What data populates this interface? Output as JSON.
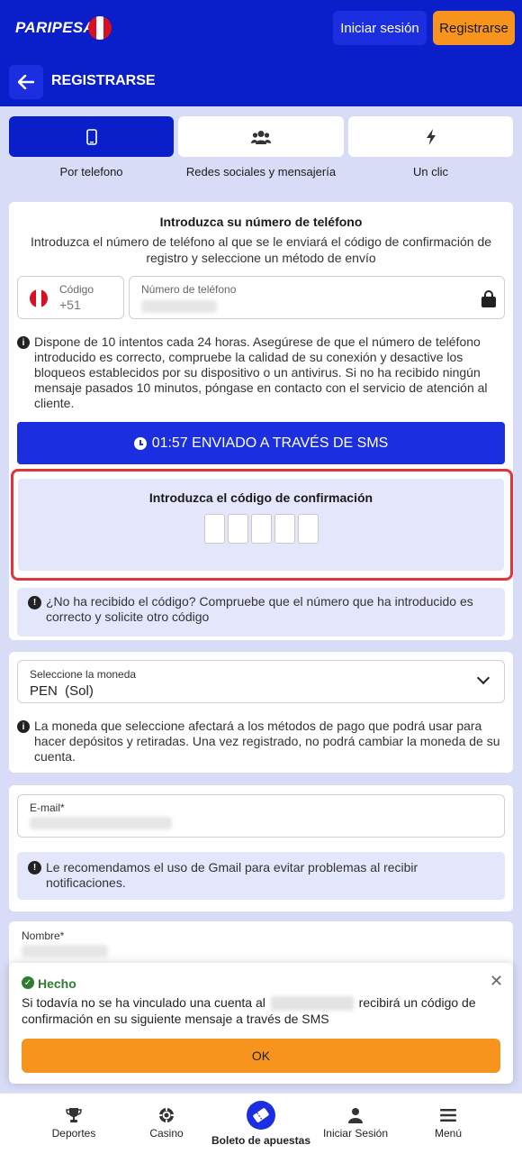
{
  "header": {
    "logo": "PARIPESA",
    "login_label": "Iniciar sesión",
    "register_label": "Registrarse"
  },
  "titlebar": {
    "title": "REGISTRARSE"
  },
  "methods": [
    {
      "label": "Por telefono",
      "icon": "smartphone-icon"
    },
    {
      "label": "Redes sociales y mensajería",
      "icon": "users-icon"
    },
    {
      "label": "Un clic",
      "icon": "lightning-icon"
    }
  ],
  "phone_section": {
    "heading": "Introduzca su número de teléfono",
    "description": "Introduzca el número de teléfono al que se le enviará el código de confirmación de registro y seleccione un método de envío",
    "code_label": "Código",
    "code_value": "+51",
    "phone_label": "Número de teléfono",
    "info": "Dispone de 10 intentos cada 24 horas. Asegúrese de que el número de teléfono introducido es correcto, compruebe la calidad de su conexión y desactive los bloqueos establecidos por su dispositivo o un antivirus. Si no ha recibido ningún mensaje pasados 10 minutos, póngase en contacto con el servicio de atención al cliente.",
    "sms_button": "01:57 ENVIADO A TRAVÉS DE SMS",
    "confirm_title": "Introduzca el código de confirmación",
    "no_code_warning": "¿No ha recibido el código? Compruebe que el número que ha introducido es correcto y solicite otro código"
  },
  "currency_section": {
    "label": "Seleccione la moneda",
    "value": "PEN  (Sol)",
    "info": "La moneda que seleccione afectará a los métodos de pago que podrá usar para hacer depósitos y retiradas. Una vez registrado, no podrá cambiar la moneda de su cuenta."
  },
  "email_section": {
    "label": "E-mail*",
    "warning": "Le recomendamos el uso de Gmail para evitar problemas al recibir notificaciones."
  },
  "name_section": {
    "label": "Nombre*"
  },
  "toast": {
    "title": "Hecho",
    "message_part1": "Si todavía no se ha vinculado una cuenta al",
    "message_part2": "recibirá un código de confirmación en su siguiente mensaje a través de SMS",
    "ok_label": "OK",
    "close_glyph": "✕"
  },
  "bottom_nav": [
    {
      "label": "Deportes",
      "icon": "trophy-icon"
    },
    {
      "label": "Casino",
      "icon": "casino-chip-icon"
    },
    {
      "label": "Boleto de apuestas",
      "icon": "ticket-icon"
    },
    {
      "label": "Iniciar Sesión",
      "icon": "user-icon"
    },
    {
      "label": "Menú",
      "icon": "menu-icon"
    }
  ],
  "colors": {
    "primary": "#0a1ec9",
    "accent": "#f7941d",
    "highlight": "#e0353b",
    "success": "#2e7d32"
  }
}
